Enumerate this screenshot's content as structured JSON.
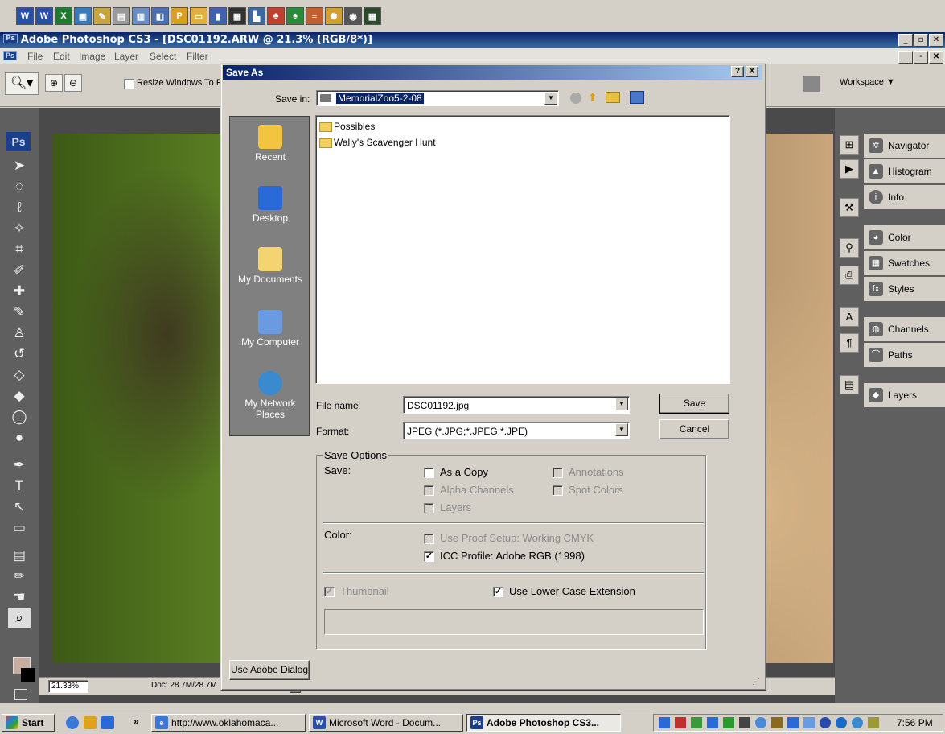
{
  "ps_window": {
    "title": "Adobe Photoshop CS3 - [DSC01192.ARW @ 21.3% (RGB/8*)]",
    "ps_badge": "Ps"
  },
  "menu": [
    "File",
    "Edit",
    "Image",
    "Layer",
    "Select",
    "Filter"
  ],
  "options_bar": {
    "resize_label": "Resize Windows To Fit",
    "workspace_label": "Workspace ▼"
  },
  "status_bar": {
    "zoom": "21.33%",
    "doc": "Doc: 28.7M/28.7M"
  },
  "panels": {
    "navigator": "Navigator",
    "histogram": "Histogram",
    "info": "Info",
    "color": "Color",
    "swatches": "Swatches",
    "styles": "Styles",
    "channels": "Channels",
    "paths": "Paths",
    "layers": "Layers"
  },
  "dialog": {
    "title": "Save As",
    "help_btn": "?",
    "close_btn": "X",
    "save_in_label": "Save in:",
    "save_in_value": "MemorialZoo5-2-08",
    "places": [
      "Recent",
      "Desktop",
      "My Documents",
      "My Computer",
      "My Network Places"
    ],
    "files": [
      "Possibles",
      "Wally's Scavenger Hunt"
    ],
    "file_name_label": "File name:",
    "file_name_value": "DSC01192.jpg",
    "format_label": "Format:",
    "format_value": "JPEG (*.JPG;*.JPEG;*.JPE)",
    "save_button": "Save",
    "cancel_button": "Cancel",
    "save_options_title": "Save Options",
    "save_label": "Save:",
    "as_a_copy": "As a Copy",
    "annotations": "Annotations",
    "alpha_channels": "Alpha Channels",
    "spot_colors": "Spot Colors",
    "layers": "Layers",
    "color_label": "Color:",
    "use_proof_setup": "Use Proof Setup:  Working CMYK",
    "icc_profile": "ICC Profile:  Adobe RGB (1998)",
    "thumbnail": "Thumbnail",
    "use_lower_case": "Use Lower Case Extension",
    "use_adobe_dialog": "Use Adobe Dialog"
  },
  "taskbar": {
    "start": "Start",
    "chevron": "»",
    "items": [
      "http://www.oklahomaca...",
      "Microsoft Word - Docum...",
      "Adobe Photoshop CS3..."
    ],
    "clock": "7:56 PM"
  },
  "colors": {
    "title_blue": "#0a246a",
    "win_gray": "#d4d0c8",
    "panel_dark": "#5f5f5f"
  }
}
